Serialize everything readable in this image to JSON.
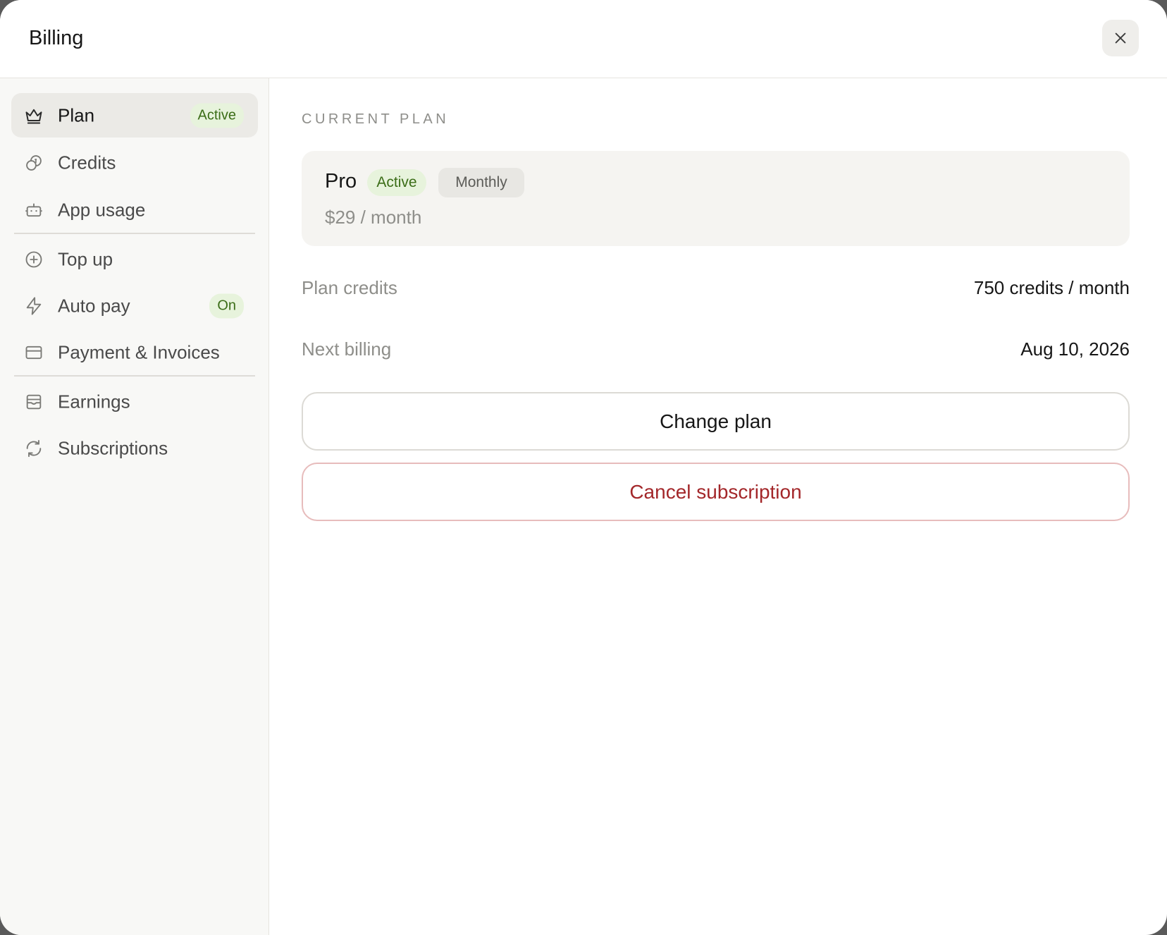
{
  "header": {
    "title": "Billing"
  },
  "sidebar": {
    "items": [
      {
        "label": "Plan",
        "icon": "crown-icon",
        "badge": "Active",
        "active": true
      },
      {
        "label": "Credits",
        "icon": "coins-icon"
      },
      {
        "label": "App usage",
        "icon": "bot-icon"
      },
      {
        "label": "Top up",
        "icon": "plus-circle-icon"
      },
      {
        "label": "Auto pay",
        "icon": "lightning-icon",
        "badge": "On"
      },
      {
        "label": "Payment & Invoices",
        "icon": "credit-card-icon"
      },
      {
        "label": "Earnings",
        "icon": "inbox-icon"
      },
      {
        "label": "Subscriptions",
        "icon": "refresh-icon"
      }
    ]
  },
  "main": {
    "section_label": "CURRENT PLAN",
    "plan": {
      "name": "Pro",
      "status": "Active",
      "interval": "Monthly",
      "price": "$29 / month"
    },
    "details": [
      {
        "label": "Plan credits",
        "value": "750 credits / month"
      },
      {
        "label": "Next billing",
        "value": "Aug 10, 2026"
      }
    ],
    "change_plan_label": "Change plan",
    "cancel_label": "Cancel subscription"
  },
  "colors": {
    "accent_green": "#3b6d17",
    "badge_green_bg": "#e7f3dc",
    "danger": "#a3272a",
    "sidebar_bg": "#f8f8f6"
  }
}
